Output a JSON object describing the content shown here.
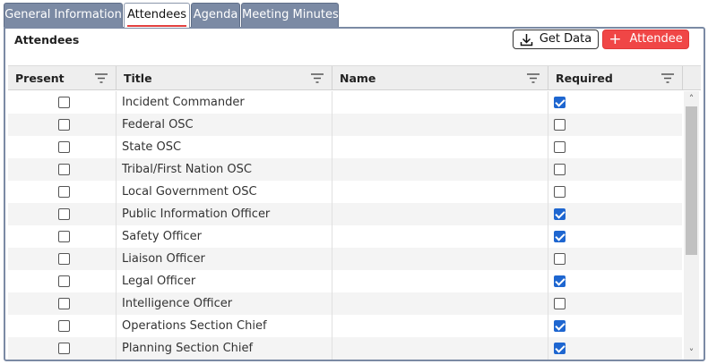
{
  "tabs": [
    {
      "label": "General Information",
      "active": false
    },
    {
      "label": "Attendees",
      "active": true
    },
    {
      "label": "Agenda",
      "active": false
    },
    {
      "label": "Meeting Minutes",
      "active": false
    }
  ],
  "panel": {
    "title": "Attendees",
    "get_data_label": "Get Data",
    "add_attendee_label": "Attendee"
  },
  "grid": {
    "columns": [
      "Present",
      "Title",
      "Name",
      "Required"
    ],
    "rows": [
      {
        "present": false,
        "title": "Incident Commander",
        "name": "",
        "required": true
      },
      {
        "present": false,
        "title": "Federal OSC",
        "name": "",
        "required": false
      },
      {
        "present": false,
        "title": "State OSC",
        "name": "",
        "required": false
      },
      {
        "present": false,
        "title": "Tribal/First Nation OSC",
        "name": "",
        "required": false
      },
      {
        "present": false,
        "title": "Local Government OSC",
        "name": "",
        "required": false
      },
      {
        "present": false,
        "title": "Public Information Officer",
        "name": "",
        "required": true
      },
      {
        "present": false,
        "title": "Safety Officer",
        "name": "",
        "required": true
      },
      {
        "present": false,
        "title": "Liaison Officer",
        "name": "",
        "required": false
      },
      {
        "present": false,
        "title": "Legal Officer",
        "name": "",
        "required": true
      },
      {
        "present": false,
        "title": "Intelligence Officer",
        "name": "",
        "required": false
      },
      {
        "present": false,
        "title": "Operations Section Chief",
        "name": "",
        "required": true
      },
      {
        "present": false,
        "title": "Planning Section Chief",
        "name": "",
        "required": true
      }
    ]
  },
  "colors": {
    "tab_inactive": "#7b8aa4",
    "accent_red": "#f04646",
    "checkbox_checked": "#1e66d0"
  },
  "icons": {
    "get_data": "download-icon",
    "add": "plus-icon",
    "filter": "filter-icon",
    "scroll_up": "chevron-up-icon",
    "scroll_down": "chevron-down-icon"
  }
}
